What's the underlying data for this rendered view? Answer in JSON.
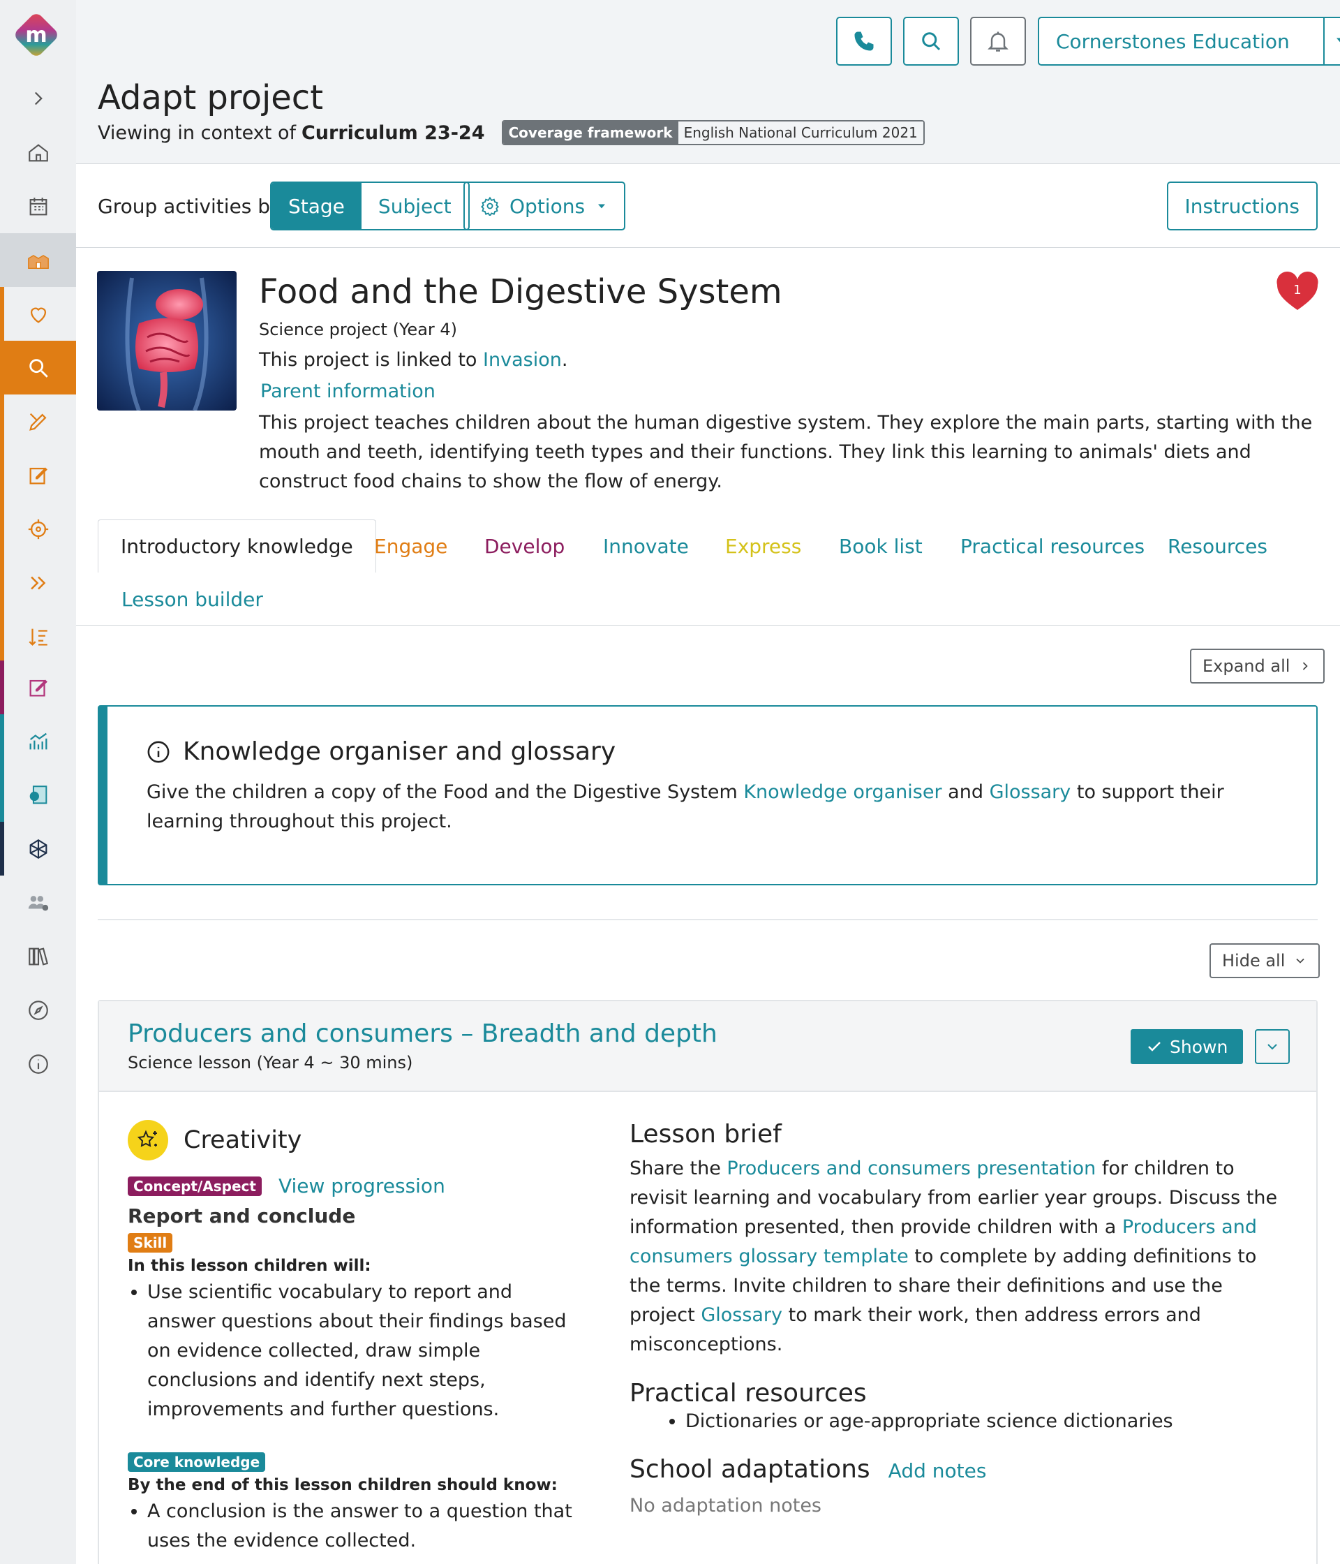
{
  "header": {
    "org_name": "Cornerstones Education",
    "page_title": "Adapt project",
    "context_prefix": "Viewing in context of",
    "context_value": "Curriculum 23-24",
    "coverage_key": "Coverage framework",
    "coverage_value": "English National Curriculum 2021"
  },
  "toolbar": {
    "group_label": "Group activities by",
    "stage_label": "Stage",
    "subject_label": "Subject",
    "options_label": "Options",
    "instructions_label": "Instructions"
  },
  "project": {
    "title": "Food and the Digestive System",
    "subtitle": "Science project (Year 4)",
    "linked_prefix": "This project is linked to",
    "linked_link": "Invasion",
    "linked_suffix": ".",
    "parent_info": "Parent information",
    "description": "This project teaches children about the human digestive system. They explore the main parts, starting with the mouth and teeth, identifying teeth types and their functions. They link this learning to animals' diets and construct food chains to show the flow of energy.",
    "favourite_count": "1"
  },
  "tabs": [
    {
      "label": "Introductory knowledge",
      "color": "#222222"
    },
    {
      "label": "Engage",
      "color": "#e07d14"
    },
    {
      "label": "Develop",
      "color": "#8c1d5e"
    },
    {
      "label": "Innovate",
      "color": "#1a8a9a"
    },
    {
      "label": "Express",
      "color": "#d4c21a"
    },
    {
      "label": "Book list",
      "color": "#1a8a9a"
    },
    {
      "label": "Practical resources",
      "color": "#1a8a9a"
    },
    {
      "label": "Resources",
      "color": "#1a8a9a"
    },
    {
      "label": "Lesson builder",
      "color": "#1a8a9a"
    }
  ],
  "controls": {
    "expand_all": "Expand all",
    "hide_all": "Hide all"
  },
  "knowledge": {
    "title": "Knowledge organiser and glossary",
    "text_1": "Give the children a copy of the Food and the Digestive System",
    "link_1": "Knowledge organiser",
    "text_2": "and",
    "link_2": "Glossary",
    "text_3": "to support their learning throughout this project."
  },
  "lesson": {
    "title": "Producers and consumers – Breadth and depth",
    "subtitle": "Science lesson (Year 4 ~ 30 mins)",
    "shown_label": "Shown",
    "strand": "Creativity",
    "concept_badge": "Concept/Aspect",
    "view_progression": "View progression",
    "concept_title": "Report and conclude",
    "skill_badge": "Skill",
    "will_heading": "In this lesson children will:",
    "will_items": [
      "Use scientific vocabulary to report and answer questions about their findings based on evidence collected, draw simple conclusions and identify next steps, improvements and further questions."
    ],
    "core_badge": "Core knowledge",
    "know_heading": "By the end of this lesson children should know:",
    "know_items": [
      "A conclusion is the answer to a question that uses the evidence collected."
    ],
    "brief_title": "Lesson brief",
    "brief_t1": "Share the",
    "brief_l1": "Producers and consumers presentation",
    "brief_t2": "for children to revisit learning and vocabulary from earlier year groups. Discuss the information presented, then provide children with a",
    "brief_l2": "Producers and consumers glossary template",
    "brief_t3": "to complete by adding definitions to the terms. Invite children to share their definitions and use the project",
    "brief_l3": "Glossary",
    "brief_t4": "to mark their work, then address errors and misconceptions.",
    "practical_title": "Practical resources",
    "practical_items": [
      "Dictionaries or age-appropriate science dictionaries"
    ],
    "adaptations_title": "School adaptations",
    "add_notes": "Add notes",
    "no_notes": "No adaptation notes"
  },
  "colors": {
    "teal": "#1a8a9a",
    "orange": "#e07d14",
    "plum": "#8c1d5e",
    "yellow": "#f5d31a",
    "heart": "#d9303c"
  }
}
